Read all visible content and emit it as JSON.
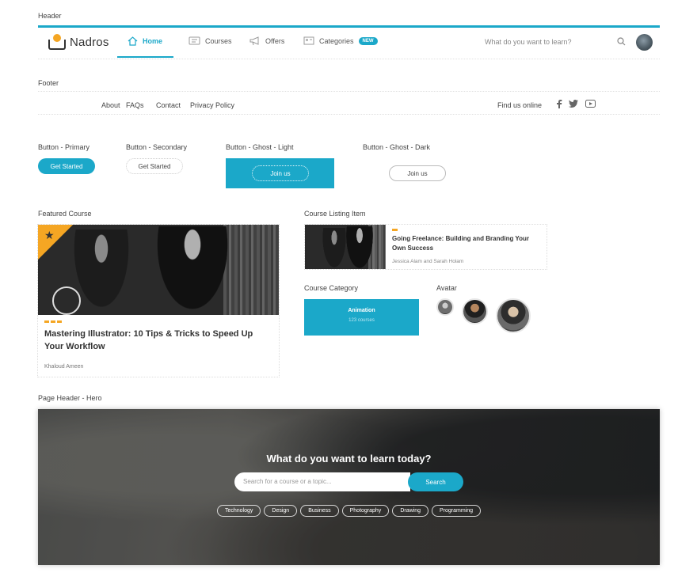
{
  "sections": {
    "header": "Header",
    "footer": "Footer",
    "btn_primary": "Button - Primary",
    "btn_secondary": "Button - Secondary",
    "btn_ghost_light": "Button - Ghost - Light",
    "btn_ghost_dark": "Button - Ghost - Dark",
    "featured_course": "Featured Course",
    "course_listing": "Course Listing Item",
    "course_category": "Course Category",
    "avatar": "Avatar",
    "hero": "Page Header - Hero"
  },
  "header": {
    "logo_text": "Nadros",
    "nav": [
      {
        "label": "Home",
        "icon": "home-icon",
        "active": true
      },
      {
        "label": "Courses",
        "icon": "courses-icon"
      },
      {
        "label": "Offers",
        "icon": "megaphone-icon"
      },
      {
        "label": "Categories",
        "icon": "categories-icon",
        "badge": "NEW"
      }
    ],
    "search_placeholder": "What do you want to learn?",
    "accent": "#1ba8c9"
  },
  "footer": {
    "links": [
      "About",
      "FAQs",
      "Contact",
      "Privacy Policy"
    ],
    "find_us": "Find us online",
    "social": [
      "facebook-icon",
      "twitter-icon",
      "youtube-icon"
    ]
  },
  "buttons": {
    "primary": "Get Started",
    "secondary": "Get Started",
    "ghost_light": "Join us",
    "ghost_dark": "Join us"
  },
  "featured": {
    "title": "Mastering Illustrator: 10 Tips & Tricks to Speed Up Your Workflow",
    "author": "Khaloud Ameen",
    "star_color": "#f5a623"
  },
  "listing": {
    "title": "Going Freelance: Building and Branding Your Own Success",
    "author": "Jessica Alam and Sarah Holam"
  },
  "category": {
    "title": "Animation",
    "subtitle": "123 courses"
  },
  "hero": {
    "title": "What do you want to learn today?",
    "placeholder": "Search for a course or a topic...",
    "search_label": "Search",
    "tags": [
      "Technology",
      "Design",
      "Business",
      "Photography",
      "Drawing",
      "Programming"
    ]
  }
}
